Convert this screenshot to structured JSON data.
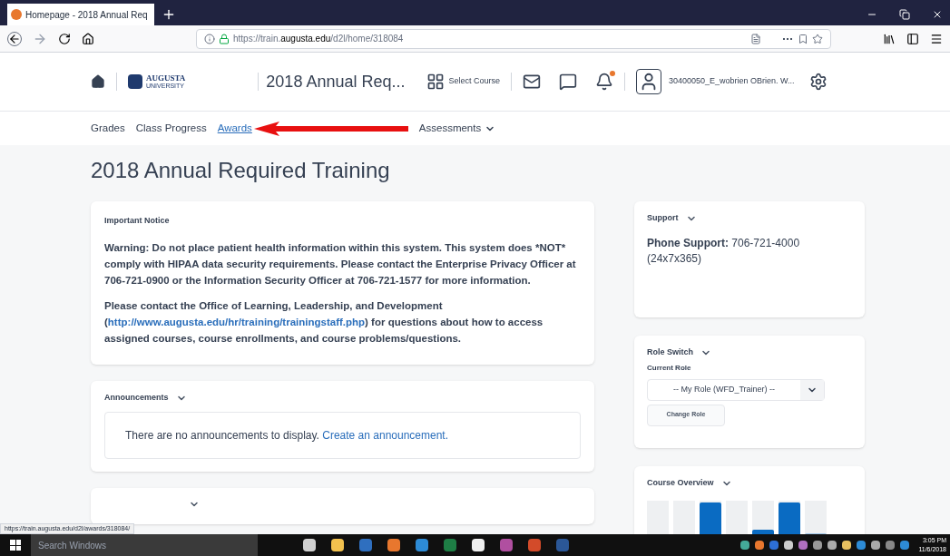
{
  "browser": {
    "tab_title": "Homepage - 2018 Annual Req",
    "url_prefix": "https://train.",
    "url_domain": "augusta.edu",
    "url_path": "/d2l/home/318084"
  },
  "header": {
    "logo_text": "AUGUSTA",
    "logo_sub": "UNIVERSITY",
    "course_name": "2018 Annual Req...",
    "select_course": "Select Course",
    "notification_alert": true,
    "user_name": "30400050_E_wobrien OBrien. W..."
  },
  "nav": [
    {
      "label": "Grades",
      "selected": false,
      "dropdown": false
    },
    {
      "label": "Class Progress",
      "selected": false,
      "dropdown": false
    },
    {
      "label": "Awards",
      "selected": true,
      "dropdown": false
    },
    {
      "label": "Assessments",
      "selected": false,
      "dropdown": true
    }
  ],
  "page_title": "2018 Annual Required Training",
  "notice": {
    "title": "Important Notice",
    "warning": "Warning: Do not place patient health information within this system. This system does *NOT* comply with HIPAA data security requirements. Please contact the Enterprise Privacy Officer at 706-721-0900 or the Information Security Officer at 706-721-1577 for more information.",
    "contact_before": "Please contact the Office of Learning, Leadership, and Development (",
    "contact_link": "http://www.augusta.edu/hr/training/trainingstaff.php",
    "contact_after": ") for questions about how to access assigned courses, course enrollments, and course problems/questions."
  },
  "announcements": {
    "title": "Announcements",
    "empty_text": "There are no announcements to display.",
    "create_link": "Create an announcement."
  },
  "support": {
    "title": "Support",
    "text": "**Phone Support:** 706-721-4000 (24x7x365)"
  },
  "role_switch": {
    "title": "Role Switch",
    "label": "Current Role",
    "value": "-- My Role (WFD_Trainer) --",
    "button": "Change Role"
  },
  "course_overview": {
    "title": "Course Overview"
  },
  "status_url": "https://train.augusta.edu/d2l/awards/318084/",
  "taskbar": {
    "search_placeholder": "Search Windows",
    "time": "3:05 PM",
    "date": "11/6/2018"
  }
}
